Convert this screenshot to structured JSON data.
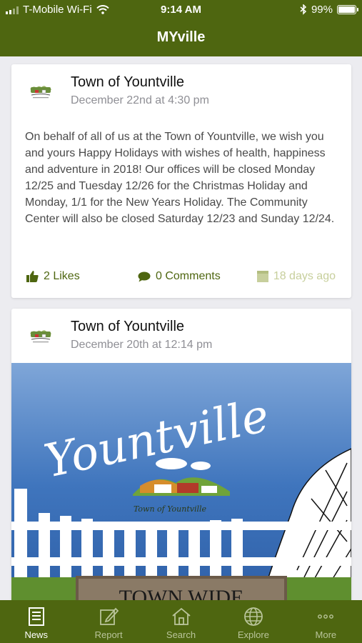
{
  "status_bar": {
    "carrier": "T-Mobile Wi-Fi",
    "time": "9:14 AM",
    "battery": "99%",
    "battery_level": 0.99,
    "icons": [
      "signal-icon",
      "wifi-icon",
      "bluetooth-icon",
      "battery-icon"
    ]
  },
  "header": {
    "title": "MYville"
  },
  "colors": {
    "brand": "#4e6610",
    "tab_inactive": "#b9c49a",
    "muted": "#8f8f95",
    "ago": "#c7cf9c",
    "background": "#ececf0"
  },
  "feed": {
    "posts": [
      {
        "author": "Town of Yountville",
        "date": "December 22nd at 4:30 pm",
        "body": "On behalf of all of us at the Town of Yountville, we wish you and yours Happy Holidays with wishes of health, happiness and adventure in 2018! Our offices will be closed Monday 12/25 and Tuesday 12/26 for the Christmas Holiday and Monday, 1/1 for the New Years Holiday. The Community Center will also be closed Saturday 12/23 and Sunday 12/24.",
        "likes": "2 Likes",
        "comments": "0 Comments",
        "ago": "18 days ago"
      },
      {
        "author": "Town of Yountville",
        "date": "December 20th at 12:14 pm",
        "image_script_text": "Yountville",
        "image_logo_text": "Town of Yountville",
        "image_sign_text": "TOWN WIDE"
      }
    ]
  },
  "tabs": [
    {
      "label": "News",
      "icon": "news-icon",
      "active": true
    },
    {
      "label": "Report",
      "icon": "report-icon",
      "active": false
    },
    {
      "label": "Search",
      "icon": "search-house-icon",
      "active": false
    },
    {
      "label": "Explore",
      "icon": "globe-icon",
      "active": false
    },
    {
      "label": "More",
      "icon": "more-icon",
      "active": false
    }
  ]
}
